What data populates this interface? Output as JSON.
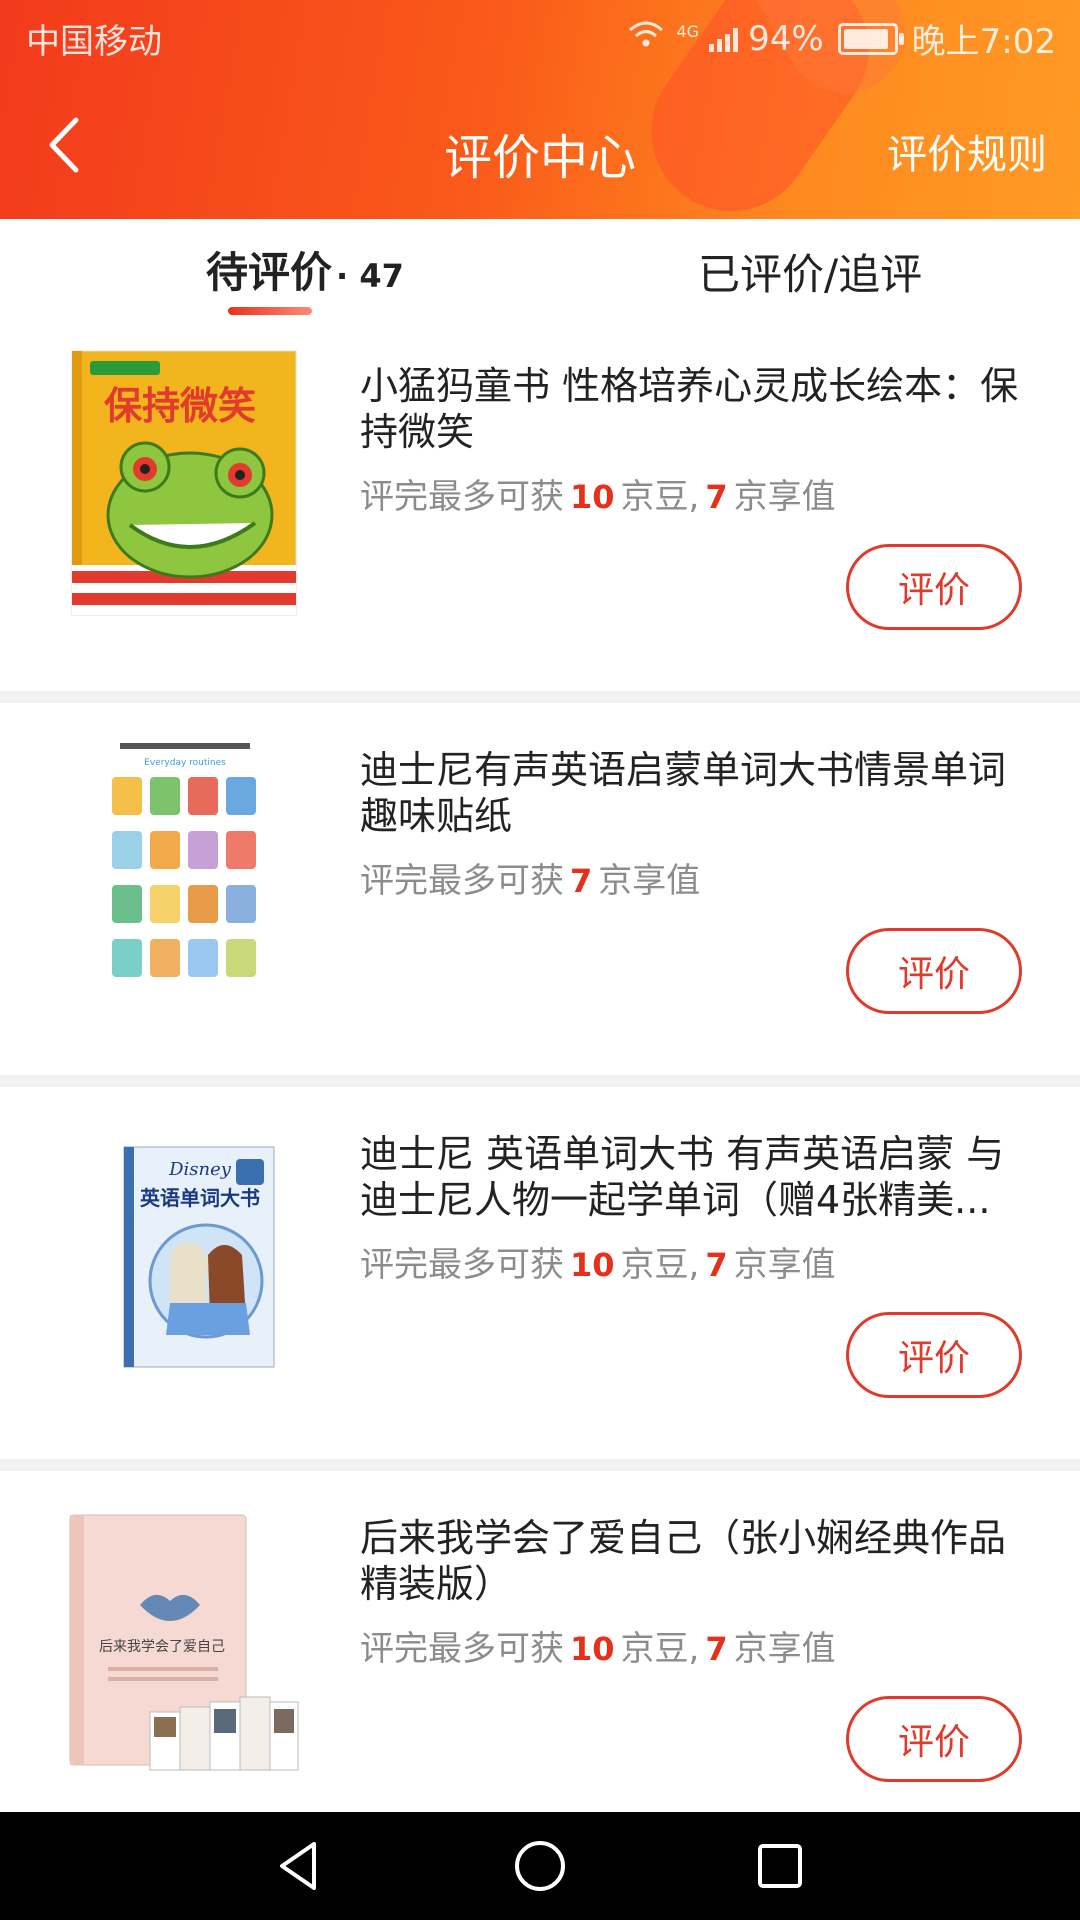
{
  "status_bar": {
    "carrier": "中国移动",
    "network": "4G",
    "battery": "94%",
    "time": "晚上7:02"
  },
  "header": {
    "title": "评价中心",
    "rules_link": "评价规则",
    "gradient_colors": [
      "#f23a1c",
      "#ff9a25"
    ]
  },
  "tabs": [
    {
      "label": "待评价",
      "count": "· 47",
      "active": true
    },
    {
      "label": "已评价/追评",
      "active": false
    }
  ],
  "reward_text": {
    "prefix": "评完最多可获",
    "beans_unit": "京豆,",
    "value_unit": "京享值"
  },
  "items": [
    {
      "title": "小猛犸童书 性格培养心灵成长绘本：保持微笑",
      "beans": "10",
      "value": "7",
      "button": "评价",
      "cover": {
        "main_text": "保持微笑",
        "color": "#f2b51e"
      }
    },
    {
      "title": "迪士尼有声英语启蒙单词大书情景单词趣味贴纸",
      "value": "7",
      "button": "评价",
      "cover": {
        "main_text": "Everyday routines",
        "color": "#ffffff"
      }
    },
    {
      "title": "迪士尼 英语单词大书 有声英语启蒙 与迪士尼人物一起学单词（赠4张精美...",
      "beans": "10",
      "value": "7",
      "button": "评价",
      "cover": {
        "main_text": "英语单词大书",
        "color": "#e8f0fa"
      }
    },
    {
      "title": "后来我学会了爱自己（张小娴经典作品精装版）",
      "beans": "10",
      "value": "7",
      "button": "评价",
      "cover": {
        "main_text": "后来我学会了爱自己",
        "color": "#f6d9d3"
      }
    }
  ],
  "accent_color": "#e5311b",
  "nav_icons": [
    "back-triangle-icon",
    "home-circle-icon",
    "recents-square-icon"
  ]
}
